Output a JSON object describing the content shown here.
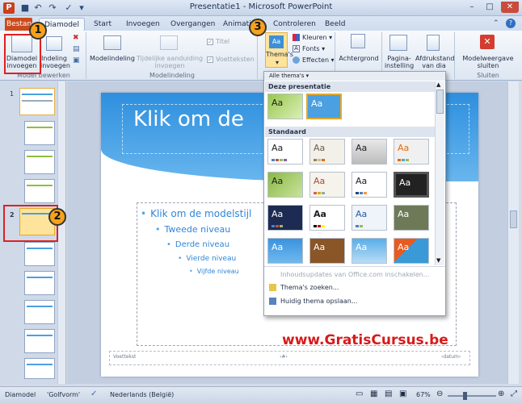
{
  "window": {
    "title": "Presentatie1 - Microsoft PowerPoint",
    "app_letter": "P"
  },
  "tabs": [
    "Bestand",
    "Diamodel",
    "Start",
    "Invoegen",
    "Overgangen",
    "Animaties",
    "Controleren",
    "Beeld"
  ],
  "ribbon": {
    "insert_slide_master": "Diamodel invoegen",
    "insert_layout": "Indeling invoegen",
    "group_edit_master": "Model bewerken",
    "master_layout": "Modelindeling",
    "layout_placeholder": "Tijdelijke aanduiding invoegen",
    "title_chk": "Titel",
    "footers_chk": "Voetteksten",
    "group_master_layout": "Modelindeling",
    "themes": "Thema's",
    "colors": "Kleuren",
    "fonts": "Fonts",
    "effects": "Effecten",
    "background": "Achtergrond",
    "page_setup": "Pagina-instelling",
    "orientation": "Afdrukstand van dia",
    "close_master": "Modelweergave sluiten",
    "group_close": "Sluiten"
  },
  "slide": {
    "title": "Klik om de",
    "levels": [
      "Klik om de modelstijl",
      "Tweede niveau",
      "Derde niveau",
      "Vierde niveau",
      "Vijfde niveau"
    ],
    "footer_left": "Voettekst",
    "footer_mid": "‹#›",
    "footer_right": "‹datum›"
  },
  "gallery": {
    "filter": "Alle thema's",
    "section_current": "Deze presentatie",
    "section_standard": "Standaard",
    "tile_text": "Aa",
    "cmd_update": "Inhoudsupdates van Office.com inschakelen...",
    "cmd_browse": "Thema's zoeken...",
    "cmd_save": "Huidig thema opslaan..."
  },
  "status": {
    "view": "Diamodel",
    "theme": "'Golfvorm'",
    "language": "Nederlands (België)",
    "zoom": "67%"
  },
  "callouts": [
    "1",
    "2",
    "3"
  ],
  "watermark": "www.GratisCursus.be",
  "colors": {
    "accent": "#2e8fde",
    "file_tab": "#cc4a1c",
    "callout": "#f6a21c",
    "redbox": "#e02020"
  }
}
